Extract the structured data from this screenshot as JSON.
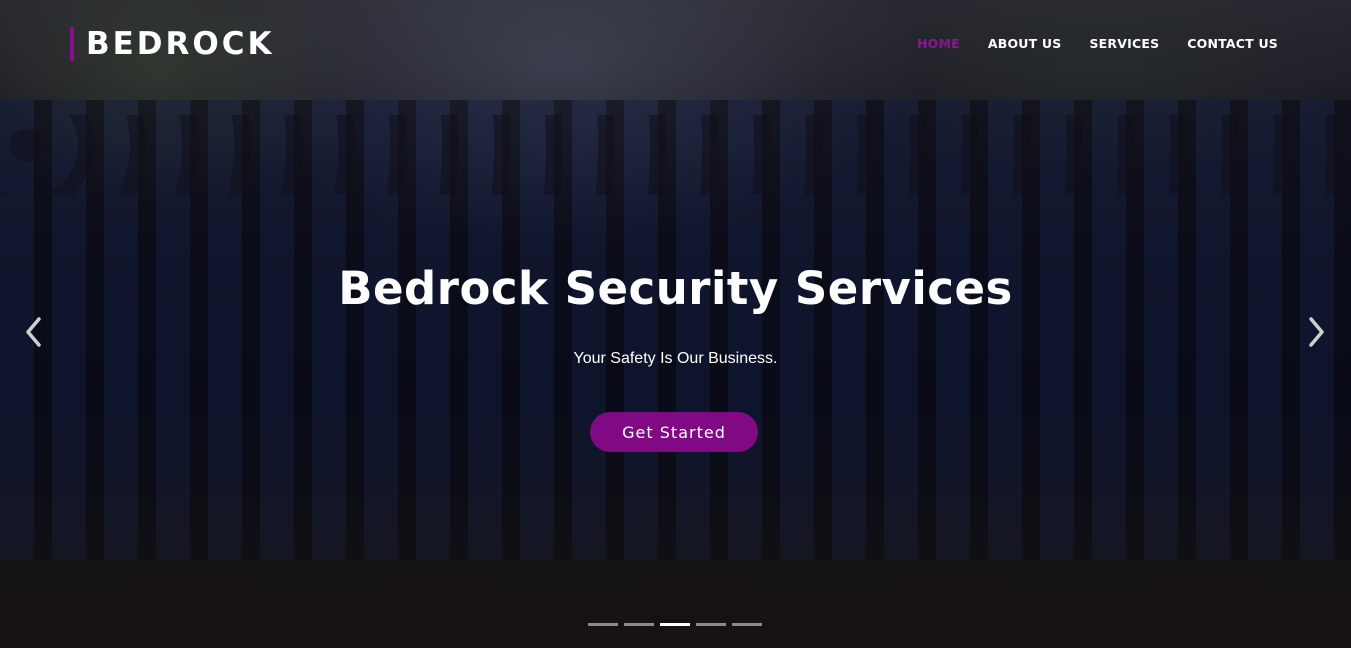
{
  "brand": {
    "name": "BEDROCK",
    "accent_color": "#8a0f8a"
  },
  "nav": {
    "items": [
      {
        "label": "HOME",
        "active": true
      },
      {
        "label": "ABOUT US",
        "active": false
      },
      {
        "label": "SERVICES",
        "active": false
      },
      {
        "label": "CONTACT US",
        "active": false
      }
    ]
  },
  "hero": {
    "title": "Bedrock Security Services",
    "subtitle": "Your Safety Is Our Business.",
    "cta_label": "Get Started",
    "cta_color": "#7f0a83"
  },
  "carousel": {
    "prev_icon": "chevron-left-icon",
    "next_icon": "chevron-right-icon",
    "slide_count": 5,
    "active_index": 2
  }
}
